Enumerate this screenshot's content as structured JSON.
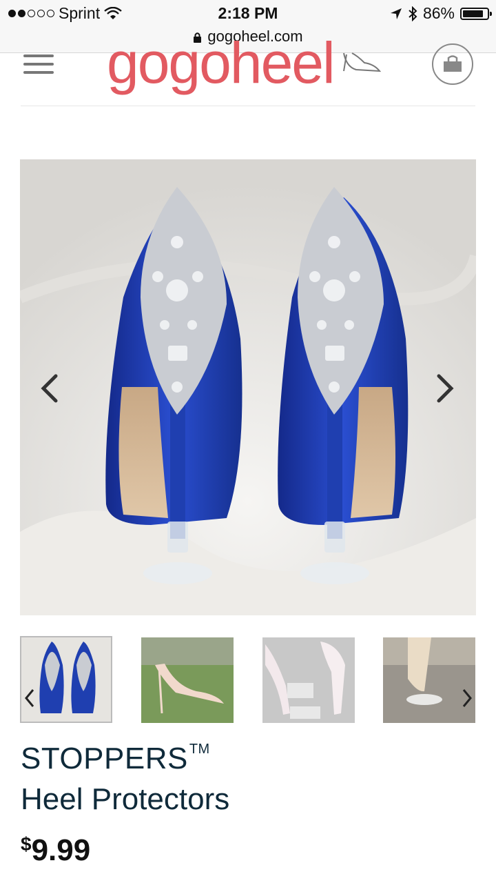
{
  "status_bar": {
    "carrier": "Sprint",
    "time": "2:18 PM",
    "battery": "86%",
    "battery_level": 0.86,
    "signal_bars": 2
  },
  "browser": {
    "url": "gogoheel.com"
  },
  "header": {
    "logo_text": "gogoheel",
    "menu_icon": "hamburger-icon",
    "cart_icon": "shopping-bag-icon"
  },
  "gallery": {
    "prev_icon": "chevron-left-icon",
    "next_icon": "chevron-right-icon",
    "selected_index": 0,
    "thumbnail_count": 4
  },
  "product": {
    "title_line1": "STOPPERS",
    "trademark": "TM",
    "title_line2": "Heel Protectors",
    "currency": "$",
    "price": "9.99"
  },
  "colors": {
    "brand": "#e25a61",
    "title": "#0f2a3a",
    "shoe_blue": "#1f3fb0"
  }
}
